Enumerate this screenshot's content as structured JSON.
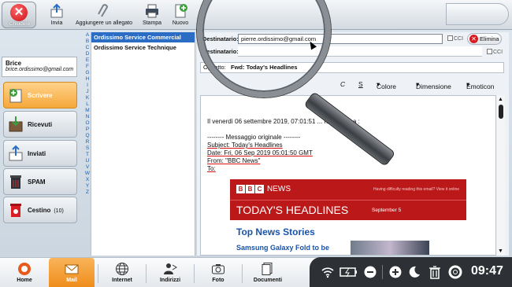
{
  "toolbar": {
    "close_label": "Chiudere",
    "send_label": "Invia",
    "attach_label": "Aggiungere un allegato",
    "print_label": "Stampa",
    "new_label": "Nuovo"
  },
  "user": {
    "name": "Brice",
    "email": "brice.ordissimo@gmail.com"
  },
  "folders": [
    {
      "label": "Scrivere",
      "icon": "compose-icon"
    },
    {
      "label": "Ricevuti",
      "icon": "inbox-icon"
    },
    {
      "label": "Inviati",
      "icon": "sent-icon"
    },
    {
      "label": "SPAM",
      "icon": "spam-bin-icon"
    },
    {
      "label": "Cestino",
      "count": "(10)",
      "icon": "trash-icon"
    }
  ],
  "alphabet": [
    "A",
    "B",
    "C",
    "D",
    "E",
    "F",
    "G",
    "H",
    "I",
    "J",
    "K",
    "L",
    "M",
    "N",
    "O",
    "P",
    "Q",
    "R",
    "S",
    "T",
    "U",
    "V",
    "W",
    "X",
    "Y",
    "Z"
  ],
  "contacts": [
    "Ordissimo Service Commercial",
    "Ordissimo Service Technique"
  ],
  "compose": {
    "to_label": "Destinatario:",
    "to_value": "pierre.ordissimo@gmail.com",
    "to2_label": "Destinatario:",
    "cc_label": "CCI",
    "delete_label": "Elimina",
    "subject_label": "Oggetto:",
    "subject_value": "Fwd: Today's Headlines",
    "format": {
      "italic": "C",
      "strike": "S",
      "color": "Colore",
      "size": "Dimensione",
      "emoticons": "Emoticon"
    }
  },
  "body": {
    "intro": "Il venerdì 06 settembre 2019, 07:01:51 ... ha inviato a :",
    "separator": "-------- Messaggio originale --------",
    "subject_line": "Subject: Today's Headlines",
    "date_line": "Date: Fri, 06 Sep 2019 05:01:50 GMT",
    "from_line": "From: \"BBC News\"",
    "to_line": "To:",
    "bbc_news": "NEWS",
    "bbc_note": "Having difficulty reading this email? View it online",
    "headline": "TODAY'S HEADLINES",
    "headline_date": "September 5",
    "top_news": "Top News Stories",
    "story": "Samsung Galaxy Fold to be"
  },
  "taskbar": [
    {
      "label": "Home",
      "icon": "home-icon"
    },
    {
      "label": "Mail",
      "icon": "mail-icon"
    },
    {
      "label": "Internet",
      "icon": "globe-icon"
    },
    {
      "label": "Indirizzi",
      "icon": "contacts-icon"
    },
    {
      "label": "Foto",
      "icon": "camera-icon"
    },
    {
      "label": "Documenti",
      "icon": "documents-icon"
    }
  ],
  "clock": "09:47",
  "colors": {
    "accent_orange": "#f6a83a",
    "selection_blue": "#2b6cc4",
    "bbc_red": "#bb1919",
    "delete_red": "#d81d24"
  }
}
